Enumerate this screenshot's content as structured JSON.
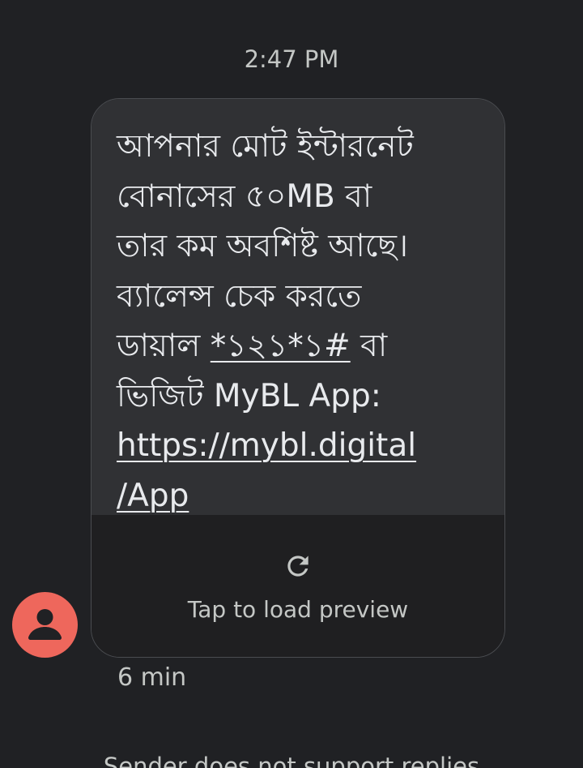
{
  "header": {
    "time": "2:47 PM"
  },
  "message": {
    "lines": [
      {
        "text": "আপনার মোট ইন্টারনেট"
      },
      {
        "text": "বোনাসের ৫০MB বা"
      },
      {
        "text": "তার কম অবশিষ্ট আছে।"
      },
      {
        "text": "ব্যালেন্স চেক করতে"
      },
      {
        "pre": "ডায়াল ",
        "link": "*১২১*১#",
        "post": " বা"
      },
      {
        "text": "ভিজিট MyBL App:"
      },
      {
        "link": "https://mybl.digital"
      },
      {
        "link": "/App"
      }
    ]
  },
  "preview": {
    "label": "Tap to load preview",
    "icon": "refresh-icon"
  },
  "avatar": {
    "icon": "person-icon",
    "color": "#ee675c"
  },
  "meta": {
    "time": "6 min"
  },
  "footer": {
    "note": "Sender does not support replies"
  }
}
